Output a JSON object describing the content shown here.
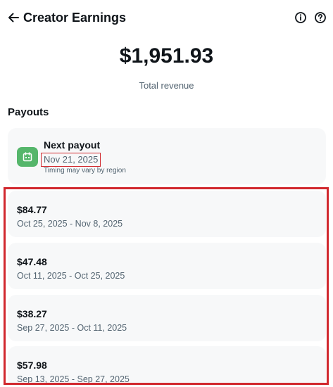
{
  "header": {
    "title": "Creator Earnings"
  },
  "summary": {
    "total_amount": "$1,951.93",
    "total_label": "Total revenue"
  },
  "payouts": {
    "section_title": "Payouts",
    "next": {
      "title": "Next payout",
      "date": "Nov 21, 2025",
      "note": "Timing may vary by region"
    },
    "items": [
      {
        "amount": "$84.77",
        "range": "Oct 25, 2025 - Nov 8, 2025"
      },
      {
        "amount": "$47.48",
        "range": "Oct 11, 2025 - Oct 25, 2025"
      },
      {
        "amount": "$38.27",
        "range": "Sep 27, 2025 - Oct 11, 2025"
      },
      {
        "amount": "$57.98",
        "range": "Sep 13, 2025 - Sep 27, 2025"
      }
    ]
  },
  "colors": {
    "calendar_badge": "#55b66b",
    "highlight_border": "#d1282e",
    "card_background": "#f7f8f9"
  },
  "icons": {
    "back": "arrow-left-icon",
    "info": "info-icon",
    "help": "help-icon",
    "calendar": "calendar-icon"
  }
}
